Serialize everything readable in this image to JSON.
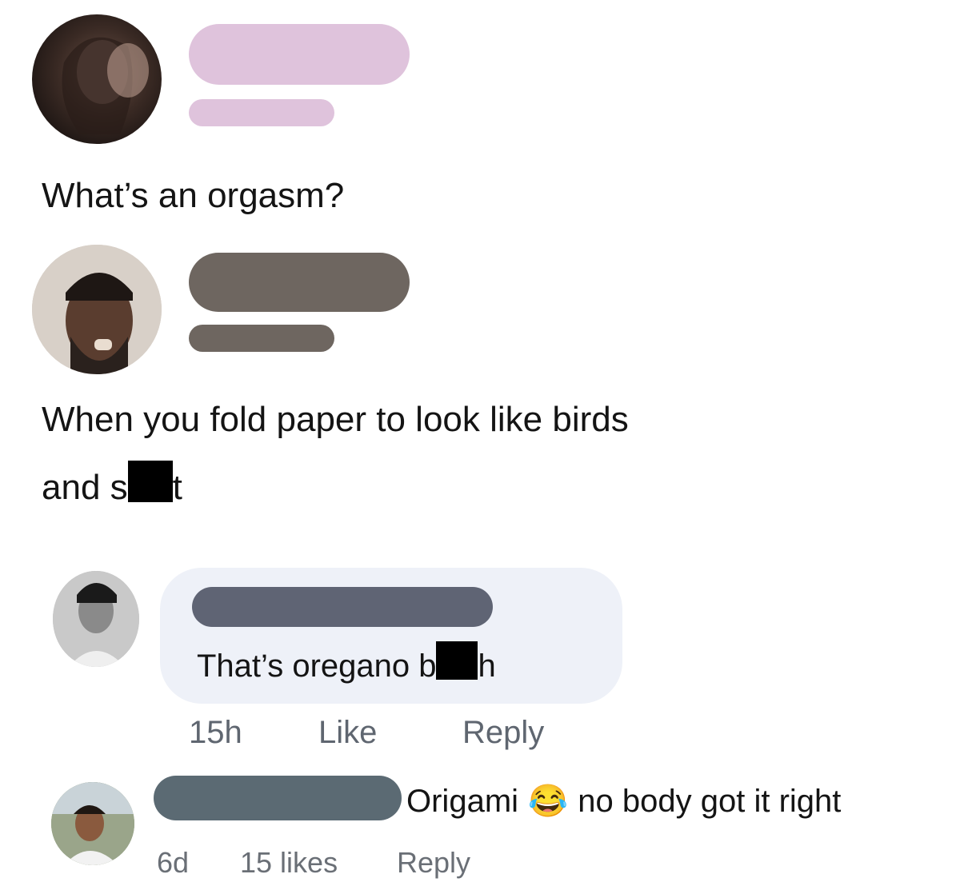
{
  "post1": {
    "text": "What’s an orgasm?",
    "name_bar_color": "#dfc3dc"
  },
  "post2": {
    "text_line1": "When you fold paper to look like birds",
    "text_line2_start": "and s",
    "text_line2_end": "t",
    "name_bar_color": "#6e6660"
  },
  "comment1": {
    "text_start": "That’s oregano b",
    "text_end": "h",
    "time": "15h",
    "like": "Like",
    "reply": "Reply",
    "name_bar_color": "#5f6474",
    "bubble_color": "#eef1f8"
  },
  "comment2": {
    "text_start": "Origami",
    "emoji": "😂",
    "text_end": "no body got it right",
    "time": "6d",
    "likes": "15 likes",
    "reply": "Reply",
    "name_bar_color": "#5b6a73"
  }
}
